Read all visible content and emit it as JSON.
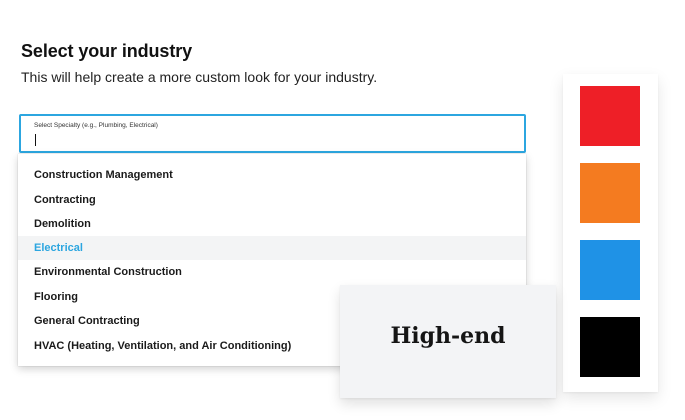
{
  "header": {
    "title": "Select your industry",
    "subtitle": "This will help create a more custom look for your industry."
  },
  "specialty_field": {
    "label": "Select Specialty (e.g., Plumbing, Electrical)",
    "value": ""
  },
  "dropdown": {
    "options": [
      "Construction Management",
      "Contracting",
      "Demolition",
      "Electrical",
      "Environmental Construction",
      "Flooring",
      "General Contracting",
      "HVAC (Heating, Ventilation, and Air Conditioning)"
    ],
    "selected": "Electrical"
  },
  "style_tag": {
    "label": "High-end"
  },
  "palette": {
    "colors": [
      "#ee1f27",
      "#f47b20",
      "#1f92e6",
      "#000000"
    ]
  },
  "accent_color": "#2ca6e0"
}
